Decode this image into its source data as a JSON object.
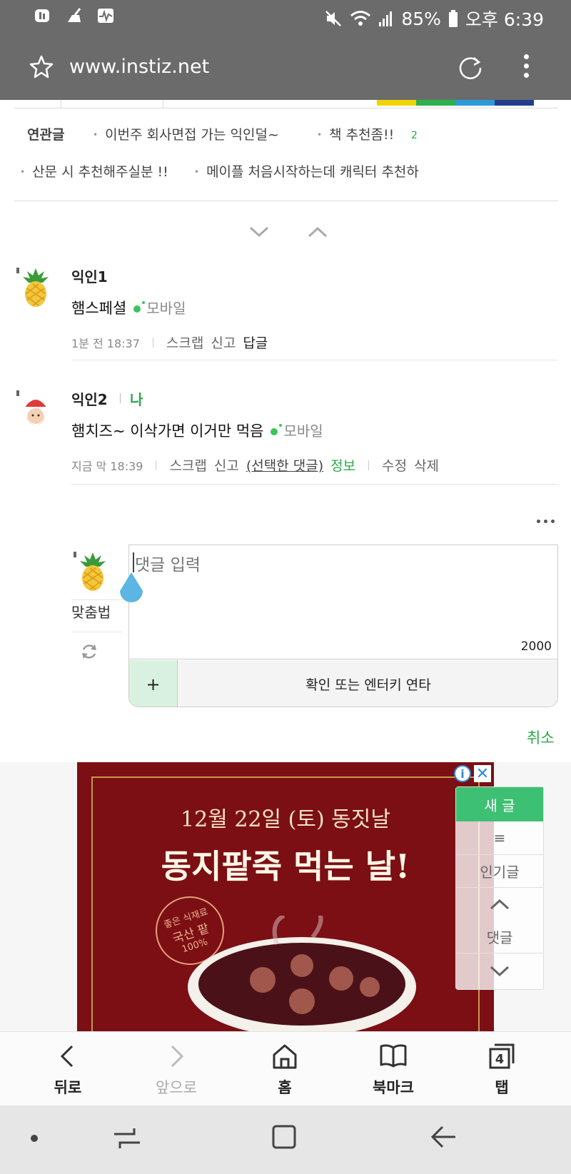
{
  "status_bar": {
    "battery": "85%",
    "time": "오후 6:39",
    "icons": [
      "ulsan-app-icon",
      "cleaner-icon",
      "pulse-icon",
      "mute-icon",
      "wifi-icon",
      "signal-icon",
      "battery-icon"
    ]
  },
  "address_bar": {
    "url": "www.instiz.net",
    "icons": [
      "star-icon",
      "reload-icon",
      "more-vert-icon"
    ]
  },
  "top_strip": {
    "colors": [
      "#f2d400",
      "#2bb24c",
      "#2a9ad8",
      "#213e8c"
    ]
  },
  "related": {
    "label": "연관글",
    "items": [
      "이번주 회사면접 가는 익인덜~",
      "책 추천좀!!",
      "산문 시 추천해주실분 !!",
      "메이플 처음시작하는데 캐릭터 추천하"
    ],
    "count": "2"
  },
  "comments": [
    {
      "name": "익인1",
      "text": "햄스페셜",
      "device": "모바일",
      "time": "1분 전 18:37",
      "actions": [
        "스크랩",
        "신고",
        "답글"
      ]
    },
    {
      "name": "익인2",
      "me": "나",
      "text": "햄치즈~ 이삭가면 이거만 먹음",
      "device": "모바일",
      "time": "지금 막 18:39",
      "actions": [
        "스크랩",
        "신고",
        "(선택한 댓글)",
        "정보",
        "수정",
        "삭제"
      ]
    }
  ],
  "reply": {
    "placeholder": "댓글 입력",
    "char_count": "2000",
    "plus_label": "+",
    "submit_label": "확인 또는 엔터키 연타",
    "fit_label": "맞춤법",
    "cancel_label": "취소"
  },
  "ad": {
    "line1": "12월 22일 (토) 동짓날",
    "line2": "동지팥죽 먹는 날!",
    "seal_top": "좋은 식재료",
    "seal_mid": "국산 팥",
    "seal_bottom": "100%",
    "info": "i",
    "close": "✕"
  },
  "float_nav": {
    "new": "새 글",
    "menu": "≡",
    "popular": "인기글",
    "comments": "댓글"
  },
  "toolbar": {
    "back": "뒤로",
    "forward": "앞으로",
    "home": "홈",
    "bookmark": "북마크",
    "tabs": "탭",
    "tab_count": "4"
  }
}
